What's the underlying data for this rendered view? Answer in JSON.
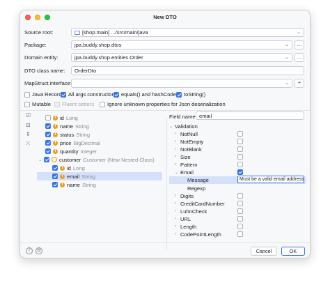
{
  "window": {
    "title": "New DTO"
  },
  "form": {
    "source_root_label": "Source root:",
    "source_root_value": "[shop.main] .../src/main/java",
    "package_label": "Package:",
    "package_value": "jpa.buddy.shop.dtos",
    "domain_entity_label": "Domain entity:",
    "domain_entity_value": "jpa.buddy.shop.entities.Order",
    "dto_class_label": "DTO class name:",
    "dto_class_value": "OrderDto",
    "mapstruct_label": "MapStruct interface:",
    "mapstruct_value": "",
    "browse_label": "...",
    "add_label": "+"
  },
  "options": [
    {
      "label": "Java Record",
      "checked": false,
      "disabled": false
    },
    {
      "label": "All args constructor",
      "checked": true,
      "disabled": false
    },
    {
      "label": "equals() and hashCode()",
      "checked": true,
      "disabled": false
    },
    {
      "label": "toString()",
      "checked": true,
      "disabled": false
    },
    {
      "label": "Mutable",
      "checked": false,
      "disabled": false
    },
    {
      "label": "Fluent setters",
      "checked": false,
      "disabled": true
    },
    {
      "label": "Ignore unknown properties for Json deserialization",
      "checked": false,
      "disabled": false
    }
  ],
  "tree": [
    {
      "name": "id",
      "type": "Long",
      "checked": false
    },
    {
      "name": "name",
      "type": "String",
      "checked": true
    },
    {
      "name": "status",
      "type": "String",
      "checked": true
    },
    {
      "name": "price",
      "type": "BigDecimal",
      "checked": true
    },
    {
      "name": "quantity",
      "type": "Integer",
      "checked": true
    },
    {
      "name": "customer",
      "type": "Customer (New Nested Class)",
      "checked": true
    },
    {
      "name": "id",
      "type": "Long",
      "checked": true
    },
    {
      "name": "email",
      "type": "String",
      "checked": true
    },
    {
      "name": "name",
      "type": "String",
      "checked": true
    }
  ],
  "field_panel": {
    "field_name_label": "Field name:",
    "field_name_value": "email",
    "validation_label": "Validation",
    "validations": [
      {
        "label": "NotNull",
        "checked": false
      },
      {
        "label": "NotEmpty",
        "checked": false
      },
      {
        "label": "NotBlank",
        "checked": false
      },
      {
        "label": "Size",
        "checked": false
      },
      {
        "label": "Pattern",
        "checked": false
      },
      {
        "label": "Email",
        "checked": true
      },
      {
        "label": "Message",
        "value": "Must be a valid email address"
      },
      {
        "label": "Regexp"
      },
      {
        "label": "Digits",
        "checked": false
      },
      {
        "label": "CreditCardNumber",
        "checked": false
      },
      {
        "label": "LuhnCheck",
        "checked": false
      },
      {
        "label": "URL",
        "checked": false
      },
      {
        "label": "Length",
        "checked": false
      },
      {
        "label": "CodePointLength",
        "checked": false
      }
    ]
  },
  "footer": {
    "help": "?",
    "settings": "⚙",
    "cancel": "Cancel",
    "ok": "OK"
  },
  "colors": {
    "accent": "#3574f0",
    "selection": "#d5e1fb",
    "field_icon": "#f29c1b"
  }
}
